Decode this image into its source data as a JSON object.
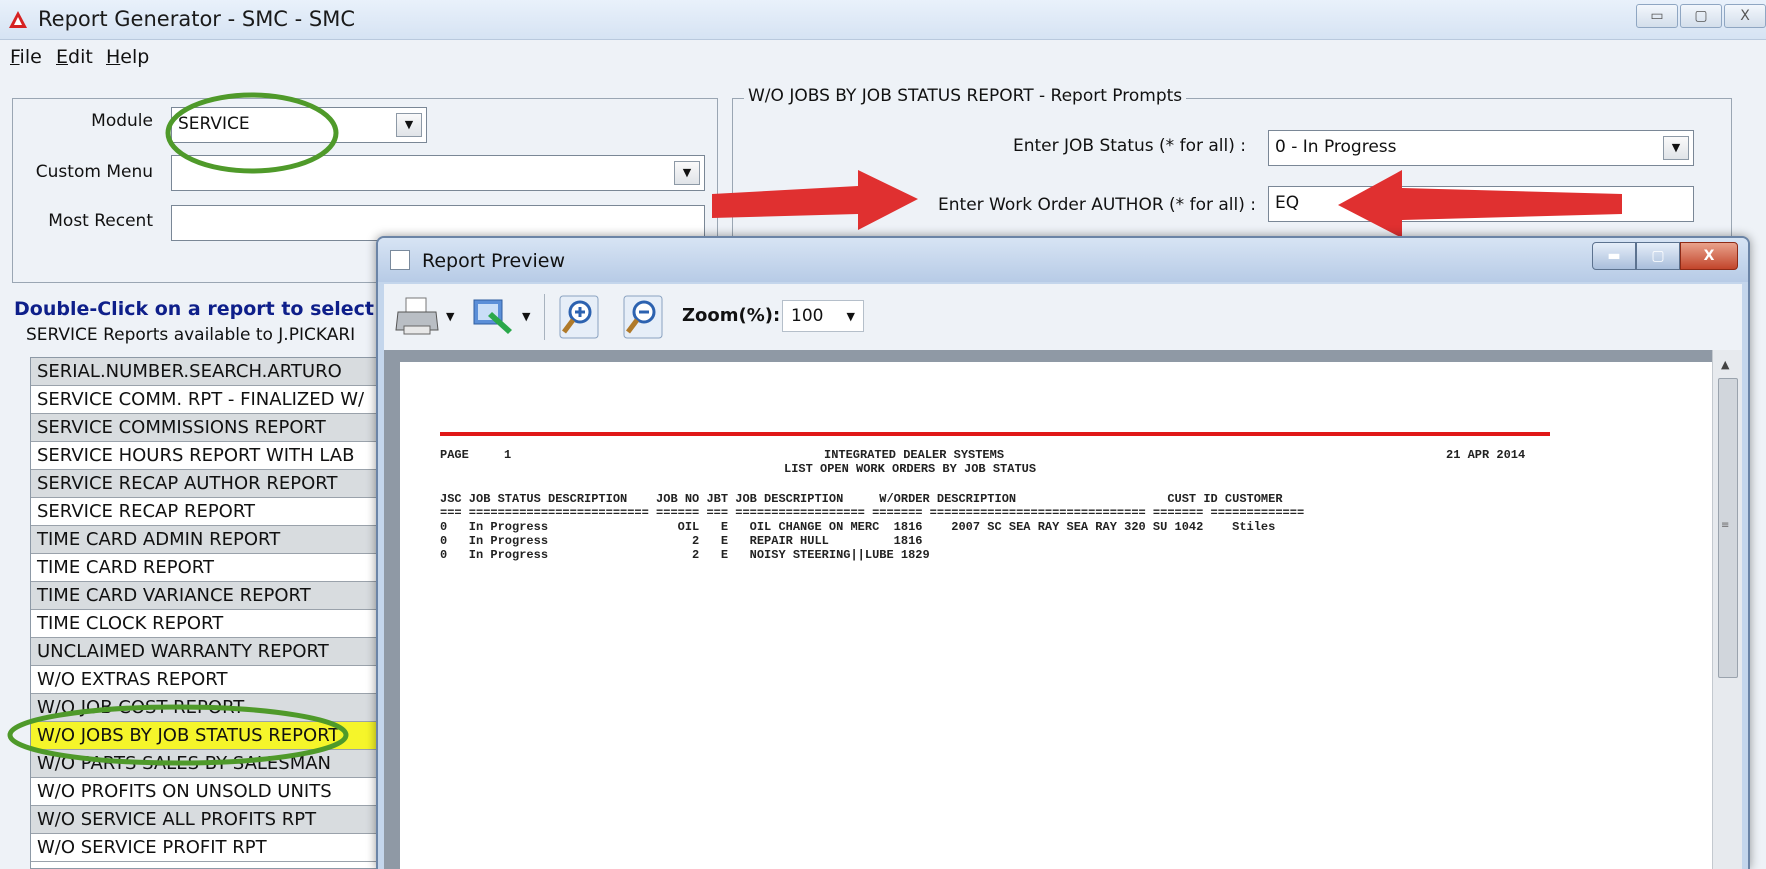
{
  "window": {
    "title": "Report Generator - SMC - SMC",
    "buttons": [
      "▭",
      "▢",
      "X"
    ]
  },
  "menu": [
    {
      "key": "F",
      "rest": "ile"
    },
    {
      "key": "E",
      "rest": "dit"
    },
    {
      "key": "H",
      "rest": "elp"
    }
  ],
  "left_panel": {
    "module_label": "Module",
    "module_value": "SERVICE",
    "custom_menu_label": "Custom Menu",
    "custom_menu_value": "",
    "most_recent_label": "Most Recent",
    "most_recent_value": ""
  },
  "instruction": "Double-Click on a report to select a",
  "reports_legend": "SERVICE Reports available to J.PICKARI",
  "reports": [
    "SERIAL.NUMBER.SEARCH.ARTURO",
    "SERVICE COMM. RPT - FINALIZED W/",
    "SERVICE COMMISSIONS REPORT",
    "SERVICE HOURS REPORT WITH LAB",
    "SERVICE RECAP AUTHOR REPORT",
    "SERVICE RECAP REPORT",
    "TIME CARD ADMIN REPORT",
    "TIME CARD REPORT",
    "TIME CARD VARIANCE REPORT",
    "TIME CLOCK REPORT",
    "UNCLAIMED WARRANTY REPORT",
    "W/O EXTRAS REPORT",
    "W/O JOB COST REPORT",
    "W/O JOBS BY JOB STATUS REPORT",
    "W/O PARTS SALES BY SALESMAN",
    "W/O PROFITS ON UNSOLD UNITS",
    "W/O SERVICE ALL PROFITS RPT",
    "W/O SERVICE PROFIT RPT"
  ],
  "selected_report": "W/O JOBS BY JOB STATUS REPORT",
  "prompts": {
    "legend": "W/O JOBS BY JOB STATUS REPORT - Report Prompts",
    "job_status_label": "Enter JOB Status (* for all) :",
    "job_status_value": "0 - In Progress",
    "author_label": "Enter Work Order AUTHOR (* for all) :",
    "author_value": "EQ"
  },
  "preview": {
    "title": "Report Preview",
    "zoom_label": "Zoom(%):",
    "zoom_value": "100",
    "buttons": [
      "▬",
      "▢",
      "X"
    ]
  },
  "report": {
    "page_label": "PAGE",
    "page_no": "1",
    "company": "INTEGRATED DEALER SYSTEMS",
    "subtitle": "LIST OPEN WORK ORDERS BY JOB STATUS",
    "date": "21 APR 2014",
    "header": "JSC JOB STATUS DESCRIPTION    JOB NO JBT JOB DESCRIPTION     W/ORDER DESCRIPTION                     CUST ID CUSTOMER",
    "rule": "=== ========================= ====== === ================== ======= ============================== ======= =============",
    "rows": [
      "0   In Progress                  OIL   E   OIL CHANGE ON MERC  1816    2007 SC SEA RAY SEA RAY 320 SU 1042    Stiles",
      "0   In Progress                    2   E   REPAIR HULL         1816",
      "0   In Progress                    2   E   NOISY STEERING||LUBE 1829"
    ]
  },
  "colors": {
    "annotation_green": "#4f9a2a",
    "arrow_red": "#e03030",
    "highlight_yellow": "#f5f52a",
    "instruction_blue": "#0e1f8a"
  }
}
